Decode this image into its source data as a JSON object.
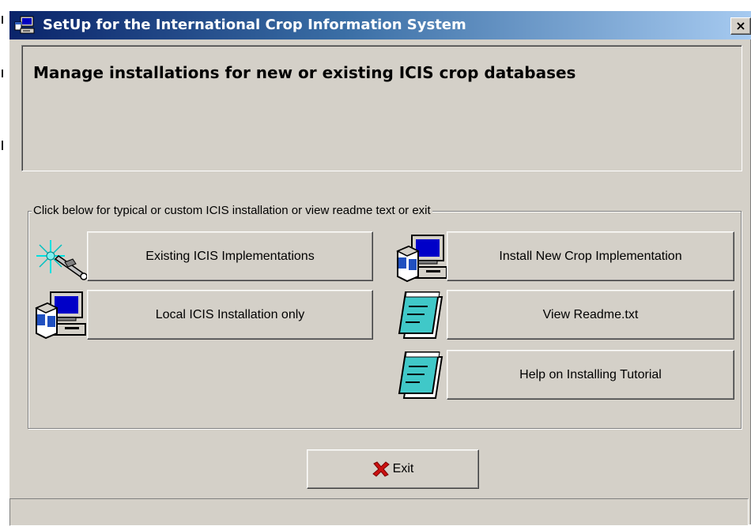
{
  "window": {
    "title": "SetUp for the International Crop Information System",
    "close_glyph": "×"
  },
  "header": {
    "text": "Manage installations for new or existing ICIS crop databases"
  },
  "group": {
    "legend": "Click below for typical or custom ICIS installation or view readme text or exit"
  },
  "buttons": {
    "existing": {
      "label": "Existing ICIS Implementations",
      "icon": "tools-icon"
    },
    "local": {
      "label": "Local ICIS Installation only",
      "icon": "computer-install-icon"
    },
    "install_new": {
      "label": "Install New Crop Implementation",
      "icon": "computer-install-icon"
    },
    "readme": {
      "label": "View Readme.txt",
      "icon": "notepad-icon"
    },
    "tutorial": {
      "label": "Help on Installing Tutorial",
      "icon": "notepad-icon"
    },
    "exit": {
      "label": "Exit",
      "icon": "red-x-icon"
    }
  },
  "colors": {
    "face": "#d4d0c8",
    "title_start": "#0a246a",
    "title_end": "#a6caf0",
    "exit_x": "#cc1010",
    "notepad": "#40c8c8"
  }
}
